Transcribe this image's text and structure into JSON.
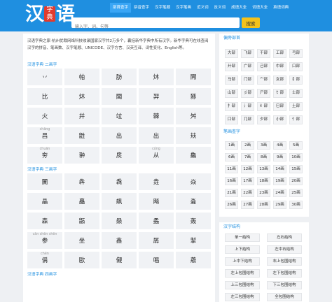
{
  "header": {
    "logo_chars": [
      "汉",
      "语"
    ],
    "logo_seal": "字典",
    "nav": [
      "部首查字",
      "拼音查字",
      "汉字笔顺",
      "汉字笔画",
      "近义词",
      "反义词",
      "成语大全",
      "词语大全",
      "英语词典"
    ],
    "search_placeholder": "输入字、词、句等",
    "search_button": "搜索"
  },
  "intro": "汉语字典之家-杭州优裁网络科技收录国家汉字共2万多个，囊括新华字典中所有汉字。新华字典可在线查阅汉字的拼音、笔画数、汉字笔顺、UNICODE、汉字方言、汉英互译、词性变化、English等。",
  "sections": [
    {
      "title": "汉语字典 二画字",
      "rows": [
        [
          {
            "py": "",
            "ch": "丷"
          },
          {
            "py": "",
            "ch": "帕"
          },
          {
            "py": "",
            "ch": "肪"
          },
          {
            "py": "",
            "ch": "炑"
          },
          {
            "py": "",
            "ch": "闁"
          }
        ],
        [
          {
            "py": "",
            "ch": "比"
          },
          {
            "py": "",
            "ch": "炑"
          },
          {
            "py": "",
            "ch": "闆"
          },
          {
            "py": "",
            "ch": "羿"
          },
          {
            "py": "",
            "ch": "豩"
          }
        ],
        [
          {
            "py": "",
            "ch": "火"
          },
          {
            "py": "",
            "ch": "幷"
          },
          {
            "py": "",
            "ch": "竝"
          },
          {
            "py": "",
            "ch": "棘"
          },
          {
            "py": "",
            "ch": "舛"
          }
        ],
        [
          {
            "py": "chāng",
            "ch": "昌"
          },
          {
            "py": "",
            "ch": "鼪"
          },
          {
            "py": "",
            "ch": "出"
          },
          {
            "py": "",
            "ch": "出"
          },
          {
            "py": "",
            "ch": "㚘"
          }
        ],
        [
          {
            "py": "chuān",
            "ch": "夯"
          },
          {
            "py": "",
            "ch": "翀"
          },
          {
            "py": "",
            "ch": "扊"
          },
          {
            "py": "cóng",
            "ch": "从"
          },
          {
            "py": "",
            "ch": "鱻"
          }
        ]
      ]
    },
    {
      "title": "汉语字典 三画字",
      "rows": [
        [
          {
            "py": "",
            "ch": "闠"
          },
          {
            "py": "",
            "ch": "犇"
          },
          {
            "py": "",
            "ch": "毳"
          },
          {
            "py": "",
            "ch": "垚"
          },
          {
            "py": "",
            "ch": "焱"
          }
        ],
        [
          {
            "py": "",
            "ch": "晶"
          },
          {
            "py": "",
            "ch": "矗"
          },
          {
            "py": "",
            "ch": "飙"
          },
          {
            "py": "",
            "ch": "飚"
          },
          {
            "py": "",
            "ch": "淼"
          }
        ],
        [
          {
            "py": "",
            "ch": "森"
          },
          {
            "py": "",
            "ch": "鼫"
          },
          {
            "py": "",
            "ch": "赑"
          },
          {
            "py": "",
            "ch": "蟊"
          },
          {
            "py": "",
            "ch": "轰"
          }
        ],
        [
          {
            "py": "cān shēn shēn",
            "ch": "参"
          },
          {
            "py": "",
            "ch": "坐"
          },
          {
            "py": "",
            "ch": "鑫"
          },
          {
            "py": "",
            "ch": "孱"
          },
          {
            "py": "",
            "ch": "掣"
          }
        ],
        [
          {
            "py": "chén",
            "ch": "偁"
          },
          {
            "py": "",
            "ch": "歐"
          },
          {
            "py": "",
            "ch": "儭"
          },
          {
            "py": "",
            "ch": "唱"
          },
          {
            "py": "",
            "ch": "譱"
          }
        ]
      ]
    },
    {
      "title": "汉语字典 四画字",
      "rows": []
    }
  ],
  "sidebar": {
    "radicals": {
      "title": "偏旁部首",
      "items": [
        "大部",
        "飞部",
        "干部",
        "工部",
        "弓部",
        "廾部",
        "广部",
        "己部",
        "巾部",
        "口部",
        "马部",
        "门部",
        "宀部",
        "女部",
        "犭部",
        "山部",
        "彡部",
        "尸部",
        "饣部",
        "士部",
        "扌部",
        "氵部",
        "纟部",
        "巳部",
        "土部",
        "囗部",
        "兀部",
        "夕部",
        "小部",
        "忄部"
      ]
    },
    "strokes": {
      "title": "笔画查字",
      "items": [
        "1画",
        "2画",
        "3画",
        "4画",
        "5画",
        "6画",
        "7画",
        "8画",
        "9画",
        "10画",
        "11画",
        "12画",
        "13画",
        "14画",
        "15画",
        "16画",
        "17画",
        "18画",
        "19画",
        "20画",
        "21画",
        "22画",
        "23画",
        "24画",
        "25画",
        "26画",
        "27画",
        "28画",
        "29画",
        "30画"
      ]
    },
    "structure": {
      "title": "汉字结构",
      "items": [
        "单一结构",
        "左右结构",
        "上下结构",
        "左中右结构",
        "上中下结构",
        "右上包围结构",
        "左上包围结构",
        "左下包围结构",
        "上三包围结构",
        "下三包围结构",
        "左三包围结构",
        "全包围结构"
      ]
    }
  }
}
